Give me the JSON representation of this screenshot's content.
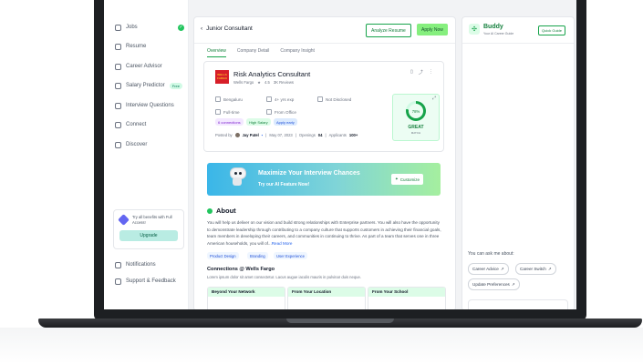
{
  "sidebar": {
    "items": [
      {
        "label": "Jobs",
        "badge": "✓"
      },
      {
        "label": "Resume"
      },
      {
        "label": "Career Advisor"
      },
      {
        "label": "Salary Predictor",
        "badge": "Free"
      },
      {
        "label": "Interview Questions"
      },
      {
        "label": "Connect"
      },
      {
        "label": "Discover"
      }
    ],
    "upgrade_card": {
      "text": "Try all benefits with Full Access!",
      "button": "Upgrade"
    },
    "bottom_items": [
      {
        "label": "Notifications"
      },
      {
        "label": "Support & Feedback"
      }
    ]
  },
  "header": {
    "back_icon": "‹",
    "title": "Junior Consultant",
    "analyze_label": "Analyze Resume",
    "apply_label": "Apply Now"
  },
  "tabs": [
    {
      "label": "Overview",
      "active": true
    },
    {
      "label": "Company Detail"
    },
    {
      "label": "Company Insight"
    }
  ],
  "job": {
    "logo_text": "WELLS FARGO",
    "title": "Risk Analytics Consultant",
    "company": "Wells Fargo",
    "rating": "4.5",
    "reviews": "3K Reviews",
    "location": "Bengaluru",
    "experience": "4+ yrs exp",
    "salary": "Not Disclosed",
    "type": "Full-time",
    "mode": "From Office",
    "tags": [
      "6 connections",
      "High Salary",
      "Apply early"
    ],
    "posted_by_label": "Posted by",
    "poster": "Jay Patel",
    "date": "May 07, 2023",
    "openings_label": "Openings",
    "openings": "04",
    "applicants_label": "Applicants",
    "applicants": "100+",
    "match": {
      "percent": "78%",
      "label": "GREAT",
      "sublabel": "MATCH",
      "value": 0.78
    }
  },
  "banner": {
    "heading": "Maximize Your Interview Chances",
    "subheading": "Try our AI Feature Now!",
    "button": "Customize"
  },
  "about": {
    "heading": "About",
    "text": "You will help us deliver on our vision and build strong relationships with Enterprise partners. You will also have the opportunity to demonstrate leadership through contributing to a company culture that supports customers in achieving their financial goals, team members in developing their careers, and communities in continuing to thrive. As part of a team that serves one in three American households, you will of...",
    "read_more": "Read More",
    "skills": [
      "Product Design",
      "Branding",
      "User Experience"
    ]
  },
  "connections": {
    "heading": "Connections @ Wells Fargo",
    "subtext": "Lorem ipsum dolor sit amet consectetur. Lacus augue iaculis mauris in pulvinar duis neque.",
    "cards": [
      "Beyond Your Network",
      "From Your Location",
      "From Your School"
    ]
  },
  "buddy": {
    "name": "Buddy",
    "subtitle": "Your AI Career Guide",
    "guide_button": "Quick Guide",
    "ask_label": "You can ask me about:",
    "chips": [
      "Career Advice",
      "Career Switch",
      "Update Preferences"
    ]
  },
  "colors": {
    "accent": "#16a34a",
    "banner_start": "#3ab6e8",
    "banner_end": "#a5ef9f"
  }
}
